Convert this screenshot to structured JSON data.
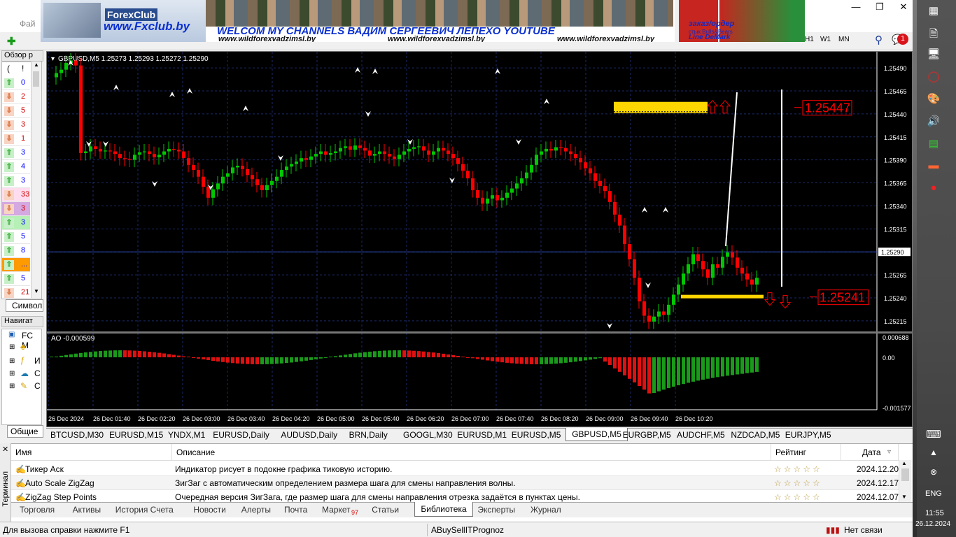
{
  "window": {
    "menu_file": "Фай",
    "toolbar_timeframes": [
      "H1",
      "W1",
      "MN"
    ],
    "notifications_count": "1"
  },
  "banner": {
    "forex_club_logo": "ForexClub",
    "fxclub_url": "www.Fxclub.by",
    "channel_text": "WELCOM MY CHANNELS ВАДИМ СЕРГЕЕВИЧ ЛЕПЕХО YOUTUBE",
    "site_1": "www.wildforexvadzimsl.by",
    "site_2": "www.wildforexvadzimsl.by",
    "site_3": "www.wildforexvadzimsl.by",
    "order_text": "заказ/ордер",
    "order_sub": "стык Bulls&Bears",
    "line_demark": "Line DeMark"
  },
  "market_watch": {
    "title": "Обзор р",
    "header_col1": "(",
    "header_col2": "!",
    "rows": [
      {
        "dir": "up",
        "value": "0"
      },
      {
        "dir": "down",
        "value": "2"
      },
      {
        "dir": "down",
        "value": "5"
      },
      {
        "dir": "down",
        "value": "3"
      },
      {
        "dir": "down",
        "value": "1"
      },
      {
        "dir": "up",
        "value": "3"
      },
      {
        "dir": "up",
        "value": "4"
      },
      {
        "dir": "up",
        "value": "3"
      },
      {
        "dir": "down",
        "value": "33"
      },
      {
        "dir": "down",
        "value": "3"
      },
      {
        "dir": "up",
        "value": "3"
      },
      {
        "dir": "up",
        "value": "5"
      },
      {
        "dir": "up",
        "value": "8"
      },
      {
        "dir": "up",
        "value": "..."
      },
      {
        "dir": "up",
        "value": "5"
      },
      {
        "dir": "down",
        "value": "21"
      }
    ],
    "symbol_tab": "Символ"
  },
  "navigator": {
    "title": "Навигат",
    "items": [
      "FC M",
      "",
      "И",
      "С",
      "С"
    ],
    "general_tab": "Общие"
  },
  "chart": {
    "symbol_info": "GBPUSD,M5  1.25273 1.25293 1.25272 1.25290",
    "ao_info": "AO -0.000599",
    "price_ticks": [
      "1.25490",
      "1.25465",
      "1.25440",
      "1.25415",
      "1.25390",
      "1.25365",
      "1.25340",
      "1.25315",
      "1.25290",
      "1.25265",
      "1.25240",
      "1.25215"
    ],
    "current_price": "1.25290",
    "ao_ticks": [
      "0.000688",
      "0.00",
      "-0.001577"
    ],
    "time_ticks": [
      "26 Dec 2024",
      "26 Dec 01:40",
      "26 Dec 02:20",
      "26 Dec 03:00",
      "26 Dec 03:40",
      "26 Dec 04:20",
      "26 Dec 05:00",
      "26 Dec 05:40",
      "26 Dec 06:20",
      "26 Dec 07:00",
      "26 Dec 07:40",
      "26 Dec 08:20",
      "26 Dec 09:00",
      "26 Dec 09:40",
      "26 Dec 10:20"
    ],
    "level_high": "1.25447",
    "level_low": "1.25241",
    "colors": {
      "bull": "#00c800",
      "bear": "#ff0000",
      "level": "#ffd700",
      "grid": "#1a2a6a"
    }
  },
  "chart_tabs": [
    "BTCUSD,M30",
    "EURUSD,M15",
    "YNDX,M1",
    "EURUSD,Daily",
    "AUDUSD,Daily",
    "BRN,Daily",
    "GOOGL,M30",
    "EURUSD,M1",
    "EURUSD,M5",
    "GBPUSD,M5",
    "EURGBP,M5",
    "AUDCHF,M5",
    "NZDCAD,M5",
    "EURJPY,M5"
  ],
  "chart_tab_active": "GBPUSD,M5",
  "terminal": {
    "side_label": "Терминал",
    "columns": {
      "name": "Имя",
      "description": "Описание",
      "rating": "Рейтинг",
      "date": "Дата"
    },
    "rows": [
      {
        "name": "Тикер Аск",
        "description": "Индикатор рисует в подокне графика тиковую историю.",
        "rating": "☆☆☆☆☆",
        "date": "2024.12.20"
      },
      {
        "name": "Auto Scale ZigZag",
        "description": "ЗигЗаг с автоматическим определением размера шага для смены направления волны.",
        "rating": "☆☆☆☆☆",
        "date": "2024.12.17"
      },
      {
        "name": "ZigZag Step Points",
        "description": "Очередная версия ЗигЗага, где размер шага для смены направления отрезка задаётся в пунктах цены.",
        "rating": "☆☆☆☆☆",
        "date": "2024.12.07"
      }
    ],
    "tabs": [
      "Торговля",
      "Активы",
      "История Счета",
      "Новости",
      "Алерты",
      "Почта",
      "Маркет",
      "Статьи",
      "Библиотека",
      "Эксперты",
      "Журнал"
    ],
    "market_badge": "97",
    "active_tab": "Библиотека"
  },
  "status": {
    "help": "Для вызова справки нажмите F1",
    "profile": "ABuySellITPrognoz",
    "connection": "Нет связи"
  },
  "taskbar": {
    "lang": "ENG",
    "time": "11:55",
    "date": "26.12.2024"
  }
}
